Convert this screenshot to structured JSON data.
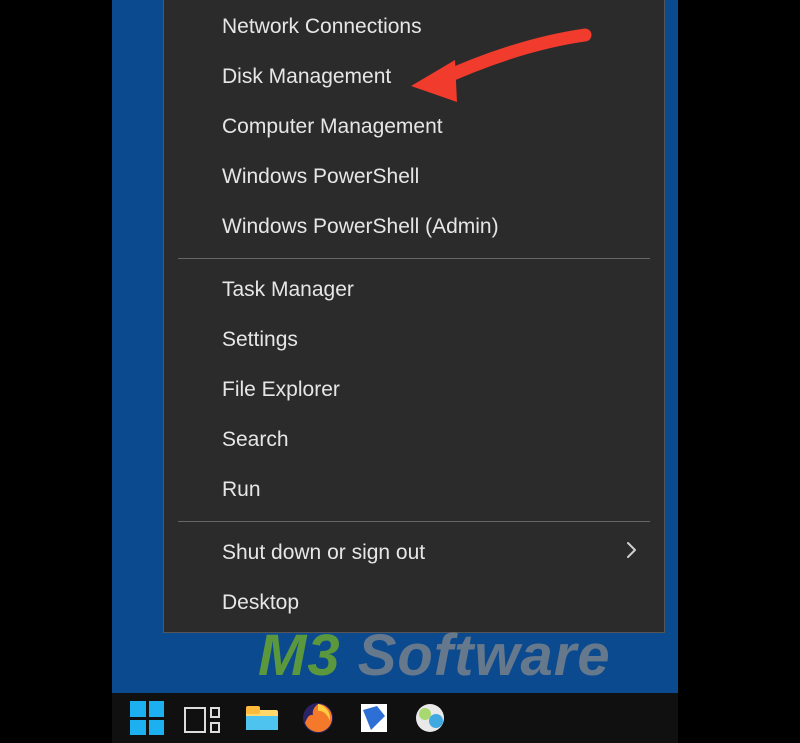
{
  "menu": {
    "items": [
      {
        "label": "Network Connections",
        "submenu": false
      },
      {
        "label": "Disk Management",
        "submenu": false
      },
      {
        "label": "Computer Management",
        "submenu": false
      },
      {
        "label": "Windows PowerShell",
        "submenu": false
      },
      {
        "label": "Windows PowerShell (Admin)",
        "submenu": false
      },
      {
        "label": "Task Manager",
        "submenu": false
      },
      {
        "label": "Settings",
        "submenu": false
      },
      {
        "label": "File Explorer",
        "submenu": false
      },
      {
        "label": "Search",
        "submenu": false
      },
      {
        "label": "Run",
        "submenu": false
      },
      {
        "label": "Shut down or sign out",
        "submenu": true
      },
      {
        "label": "Desktop",
        "submenu": false
      }
    ],
    "separators_after_index": [
      4,
      9
    ]
  },
  "annotation": {
    "arrow_target": "Disk Management",
    "arrow_color": "#f03b2d"
  },
  "watermark": {
    "part1": "M3",
    "part2": " Software"
  },
  "taskbar": {
    "start_icon": "windows-logo",
    "taskview_icon": "task-view",
    "pinned": [
      {
        "name": "file-explorer-icon"
      },
      {
        "name": "firefox-icon"
      },
      {
        "name": "document-icon"
      },
      {
        "name": "app-icon"
      }
    ]
  }
}
